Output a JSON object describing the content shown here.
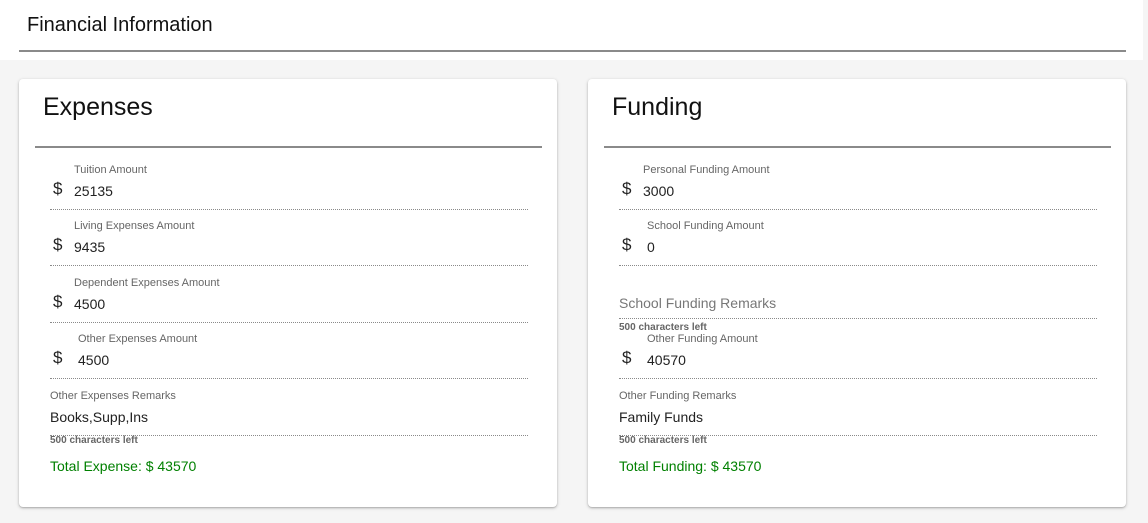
{
  "section": {
    "title": "Financial Information"
  },
  "expenses": {
    "title": "Expenses",
    "currency_symbol": "$",
    "tuition": {
      "label": "Tuition Amount",
      "value": "25135"
    },
    "living": {
      "label": "Living Expenses Amount",
      "value": "9435"
    },
    "dependent": {
      "label": "Dependent Expenses Amount",
      "value": "4500"
    },
    "other": {
      "label": "Other Expenses Amount",
      "value": "4500"
    },
    "remarks": {
      "label": "Other Expenses Remarks",
      "value": "Books,Supp,Ins",
      "chars_left": "500 characters left"
    },
    "total": "Total Expense: $ 43570"
  },
  "funding": {
    "title": "Funding",
    "currency_symbol": "$",
    "personal": {
      "label": "Personal Funding Amount",
      "value": "3000"
    },
    "school": {
      "label": "School Funding Amount",
      "value": "0"
    },
    "school_remarks": {
      "placeholder": "School Funding Remarks",
      "chars_left": "500 characters left"
    },
    "other": {
      "label": "Other Funding Amount",
      "value": "40570"
    },
    "remarks": {
      "label": "Other Funding Remarks",
      "value": "Family Funds",
      "chars_left": "500 characters left"
    },
    "total": "Total Funding: $ 43570"
  },
  "colors": {
    "total_text": "#008000",
    "rule": "#8a8a8a"
  }
}
